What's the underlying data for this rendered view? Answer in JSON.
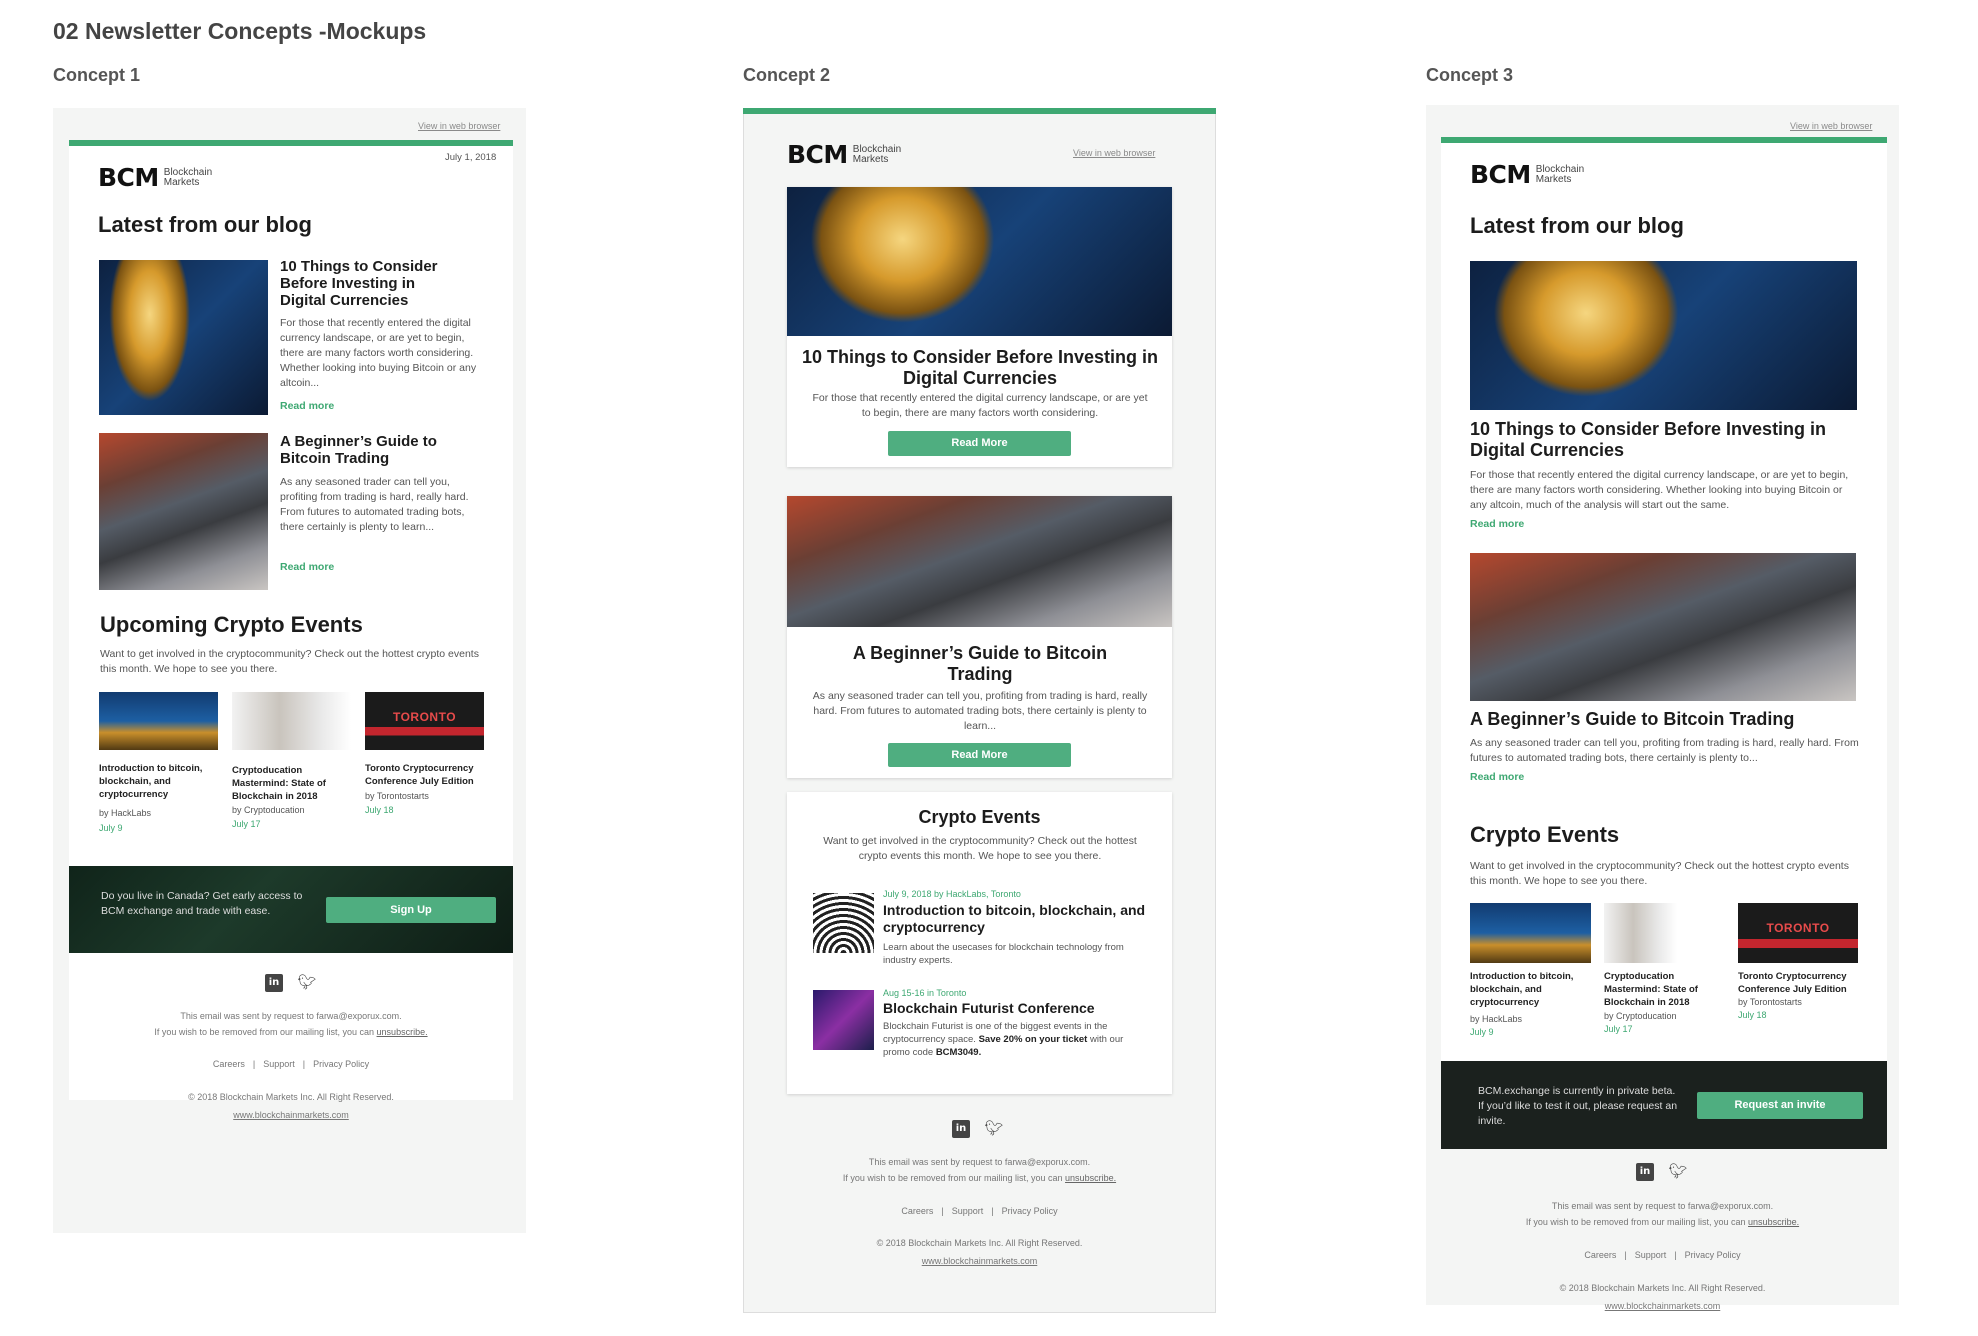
{
  "page_title": "02 Newsletter Concepts -Mockups",
  "colors": {
    "accent": "#3ea872",
    "dark": "#1c1c1c",
    "panel": "#f4f5f4"
  },
  "common": {
    "logo_text": "BCM",
    "logo_sub_1": "Blockchain",
    "logo_sub_2": "Markets",
    "view_link": "View in web browser",
    "read_more": "Read more",
    "read_more_btn": "Read More",
    "footer_sent": "This email was sent by request to farwa@exporux.com.",
    "footer_remove": "If you wish to be removed from our mailing list, you can",
    "footer_unsub": "unsubscribe.",
    "footer_links": [
      "Careers",
      "Support",
      "Privacy Policy"
    ],
    "footer_copy": "© 2018 Blockchain Markets Inc. All Right Reserved.",
    "footer_url": "www.blockchainmarkets.com",
    "social_icons": [
      "linkedin-icon",
      "twitter-icon"
    ]
  },
  "concept1": {
    "label": "Concept 1",
    "date": "July 1, 2018",
    "blog_heading": "Latest from our blog",
    "posts": [
      {
        "title": "10 Things to Consider Before Investing in Digital Currencies",
        "excerpt": "For those that recently entered the digital currency landscape, or are yet to begin, there are many factors worth considering. Whether looking into buying Bitcoin or any altcoin..."
      },
      {
        "title": "A Beginner’s Guide to Bitcoin Trading",
        "excerpt": "As any seasoned trader can tell you, profiting from trading is hard, really hard. From futures to automated trading bots, there certainly is plenty to learn..."
      }
    ],
    "events_heading": "Upcoming Crypto Events",
    "events_intro": "Want to get involved in the cryptocommunity? Check out the hottest crypto events this month. We hope to see you there.",
    "events": [
      {
        "title": "Introduction to bitcoin, blockchain, and cryptocurrency",
        "by": "by HackLabs",
        "date": "July 9"
      },
      {
        "title": "Cryptoducation Mastermind: State of Blockchain in 2018",
        "by": "by Cryptoducation",
        "date": "July 17"
      },
      {
        "title": "Toronto Cryptocurrency Conference July Edition",
        "by": "by Torontostarts",
        "date": "July 18"
      }
    ],
    "event_image_text": "TORONTO",
    "banner_text": "Do you live in Canada? Get early access to BCM exchange and trade with ease.",
    "banner_button": "Sign Up"
  },
  "concept2": {
    "label": "Concept 2",
    "posts": [
      {
        "title": "10 Things to Consider Before Investing in Digital Currencies",
        "excerpt": "For those that recently entered the digital currency landscape, or are yet to begin, there are many factors worth considering."
      },
      {
        "title": "A Beginner’s Guide to Bitcoin Trading",
        "excerpt": "As any seasoned trader can tell you, profiting from trading is hard, really hard. From futures to automated trading bots, there certainly is plenty to learn..."
      }
    ],
    "events_heading": "Crypto Events",
    "events_intro": "Want to get involved in the cryptocommunity? Check out the hottest crypto events this month. We hope to see you there.",
    "events": [
      {
        "meta": "July 9, 2018 by HackLabs, Toronto",
        "title": "Introduction to bitcoin, blockchain, and cryptocurrency",
        "desc": "Learn about the usecases for blockchain technology from industry experts."
      },
      {
        "meta": "Aug 15-16 in Toronto",
        "title": "Blockchain Futurist Conference",
        "desc_1": "Blockchain Futurist is one of the biggest events in the cryptocurrency space.",
        "desc_bold": "Save 20% on your ticket",
        "desc_2": "with our promo code",
        "promo": "BCM3049."
      }
    ]
  },
  "concept3": {
    "label": "Concept 3",
    "blog_heading": "Latest from our blog",
    "posts": [
      {
        "title": "10 Things to Consider Before Investing in Digital Currencies",
        "excerpt": "For those that recently entered the digital currency landscape, or are yet to begin, there are many factors worth considering. Whether looking into buying Bitcoin or any altcoin, much of the analysis will start out the same."
      },
      {
        "title": "A Beginner’s Guide to Bitcoin Trading",
        "excerpt": "As any seasoned trader can tell you, profiting from trading is hard, really hard. From futures to automated trading bots, there certainly is plenty to..."
      }
    ],
    "events_heading": "Crypto Events",
    "events_intro": "Want to get involved in the cryptocommunity? Check out the hottest crypto events this month. We hope to see you there.",
    "events": [
      {
        "title": "Introduction to bitcoin, blockchain, and cryptocurrency",
        "by": "by HackLabs",
        "date": "July 9"
      },
      {
        "title": "Cryptoducation Mastermind: State of Blockchain in 2018",
        "by": "by Cryptoducation",
        "date": "July 17"
      },
      {
        "title": "Toronto Cryptocurrency Conference July Edition",
        "by": "by Torontostarts",
        "date": "July 18"
      }
    ],
    "event_image_text": "TORONTO",
    "banner_text": "BCM.exchange is currently in private beta. If you’d like to test it out, please request an invite.",
    "banner_button": "Request an invite"
  }
}
